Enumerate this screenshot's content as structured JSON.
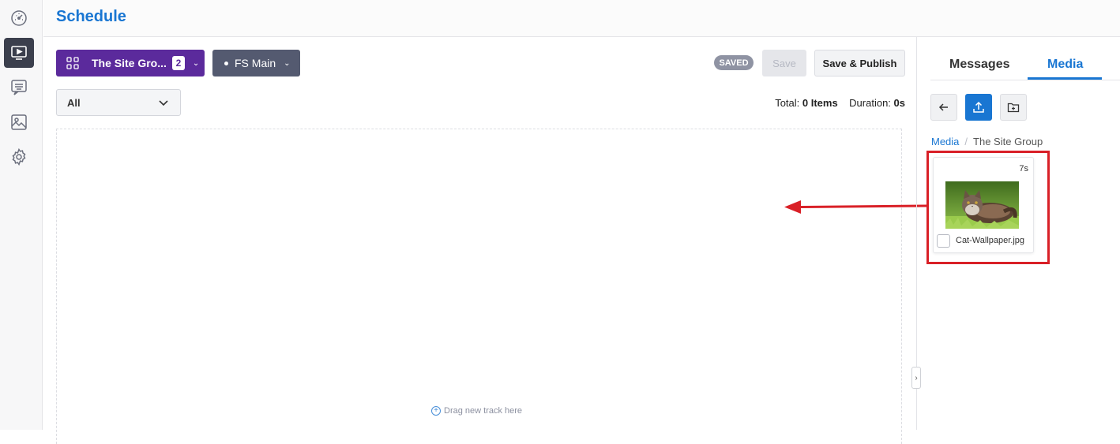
{
  "page": {
    "title": "Schedule"
  },
  "rail": {
    "items": [
      {
        "name": "dashboard",
        "icon": "speedometer-icon",
        "active": false
      },
      {
        "name": "schedule",
        "icon": "monitor-play-icon",
        "active": true
      },
      {
        "name": "messages",
        "icon": "message-lines-icon",
        "active": false
      },
      {
        "name": "media",
        "icon": "image-icon",
        "active": false
      },
      {
        "name": "settings",
        "icon": "gear-icon",
        "active": false
      }
    ]
  },
  "toolbar": {
    "group_label": "The Site Gro...",
    "group_count": "2",
    "channel_label": "FS Main",
    "status_badge": "SAVED",
    "save_label": "Save",
    "publish_label": "Save & Publish"
  },
  "filter": {
    "selected": "All"
  },
  "totals": {
    "total_prefix": "Total:",
    "total_value": "0 Items",
    "duration_prefix": "Duration:",
    "duration_value": "0s"
  },
  "dropzone": {
    "hint": "Drag new track here"
  },
  "panel": {
    "tabs": [
      {
        "label": "Messages"
      },
      {
        "label": "Media"
      }
    ],
    "active_tab": "Media",
    "breadcrumb": {
      "root": "Media",
      "separator": "/",
      "current": "The Site Group"
    },
    "media_items": [
      {
        "name": "Cat-Wallpaper.jpg",
        "duration": "7s",
        "checked": false
      }
    ]
  },
  "colors": {
    "accent": "#1976d2",
    "group_button": "#5b2a9c",
    "channel_button": "#545a70",
    "highlight": "#d92027"
  }
}
